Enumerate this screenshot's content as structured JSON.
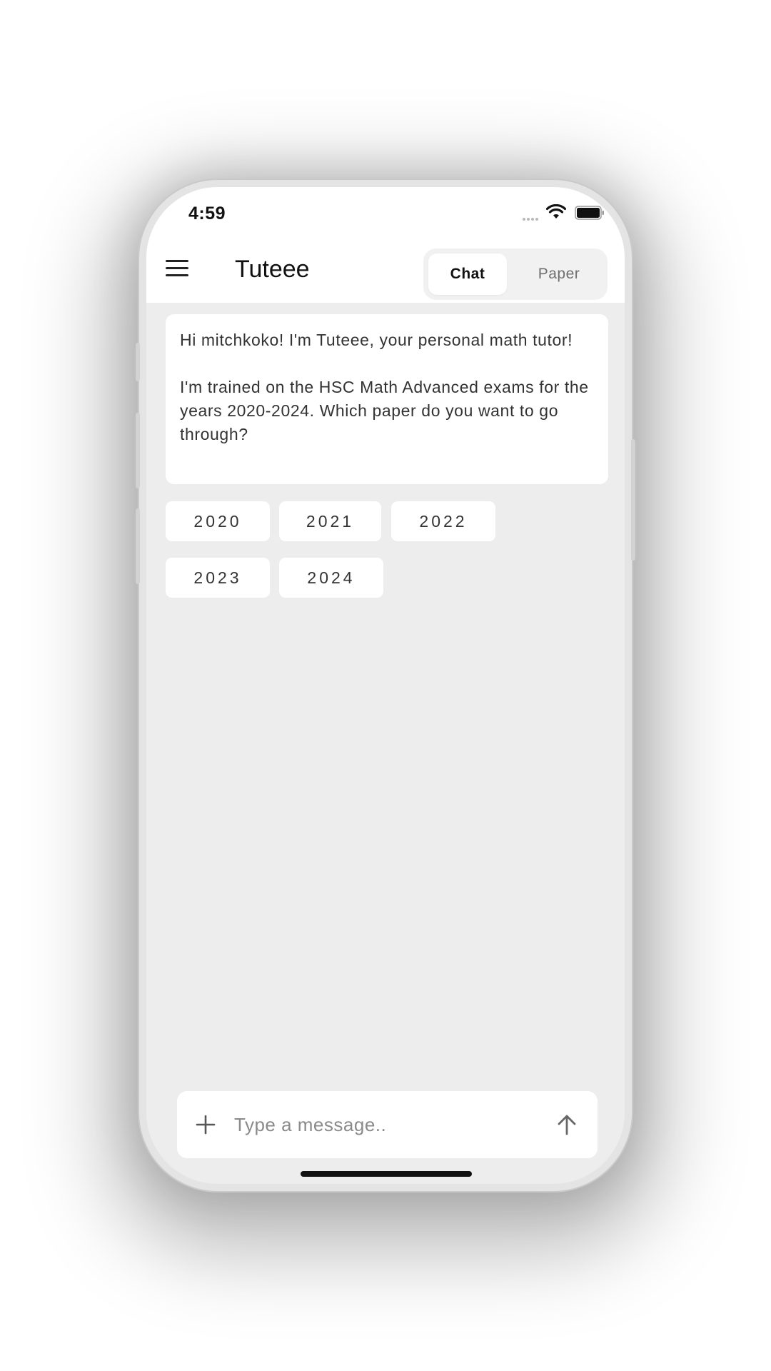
{
  "status_bar": {
    "time": "4:59",
    "signal_icon": "signal-dots-icon",
    "wifi_icon": "wifi-icon",
    "battery_icon": "battery-full-icon"
  },
  "header": {
    "menu_icon": "hamburger-menu-icon",
    "title": "Tuteee",
    "tabs": [
      {
        "label": "Chat",
        "selected": true
      },
      {
        "label": "Paper",
        "selected": false
      }
    ]
  },
  "chat": {
    "messages": [
      {
        "sender": "assistant",
        "paragraphs": [
          "Hi mitchkoko! I'm Tuteee, your personal math tutor!",
          "I'm trained on the HSC Math Advanced exams for the years 2020-2024. Which paper do you want to go through?"
        ]
      }
    ],
    "year_options": [
      "2020",
      "2021",
      "2022",
      "2023",
      "2024"
    ]
  },
  "composer": {
    "add_icon": "plus-icon",
    "placeholder": "Type a message..",
    "value": "",
    "send_icon": "arrow-up-icon"
  },
  "colors": {
    "background": "#ededed",
    "surface": "#ffffff",
    "text_primary": "#111111",
    "text_secondary": "#6f6f6f"
  }
}
